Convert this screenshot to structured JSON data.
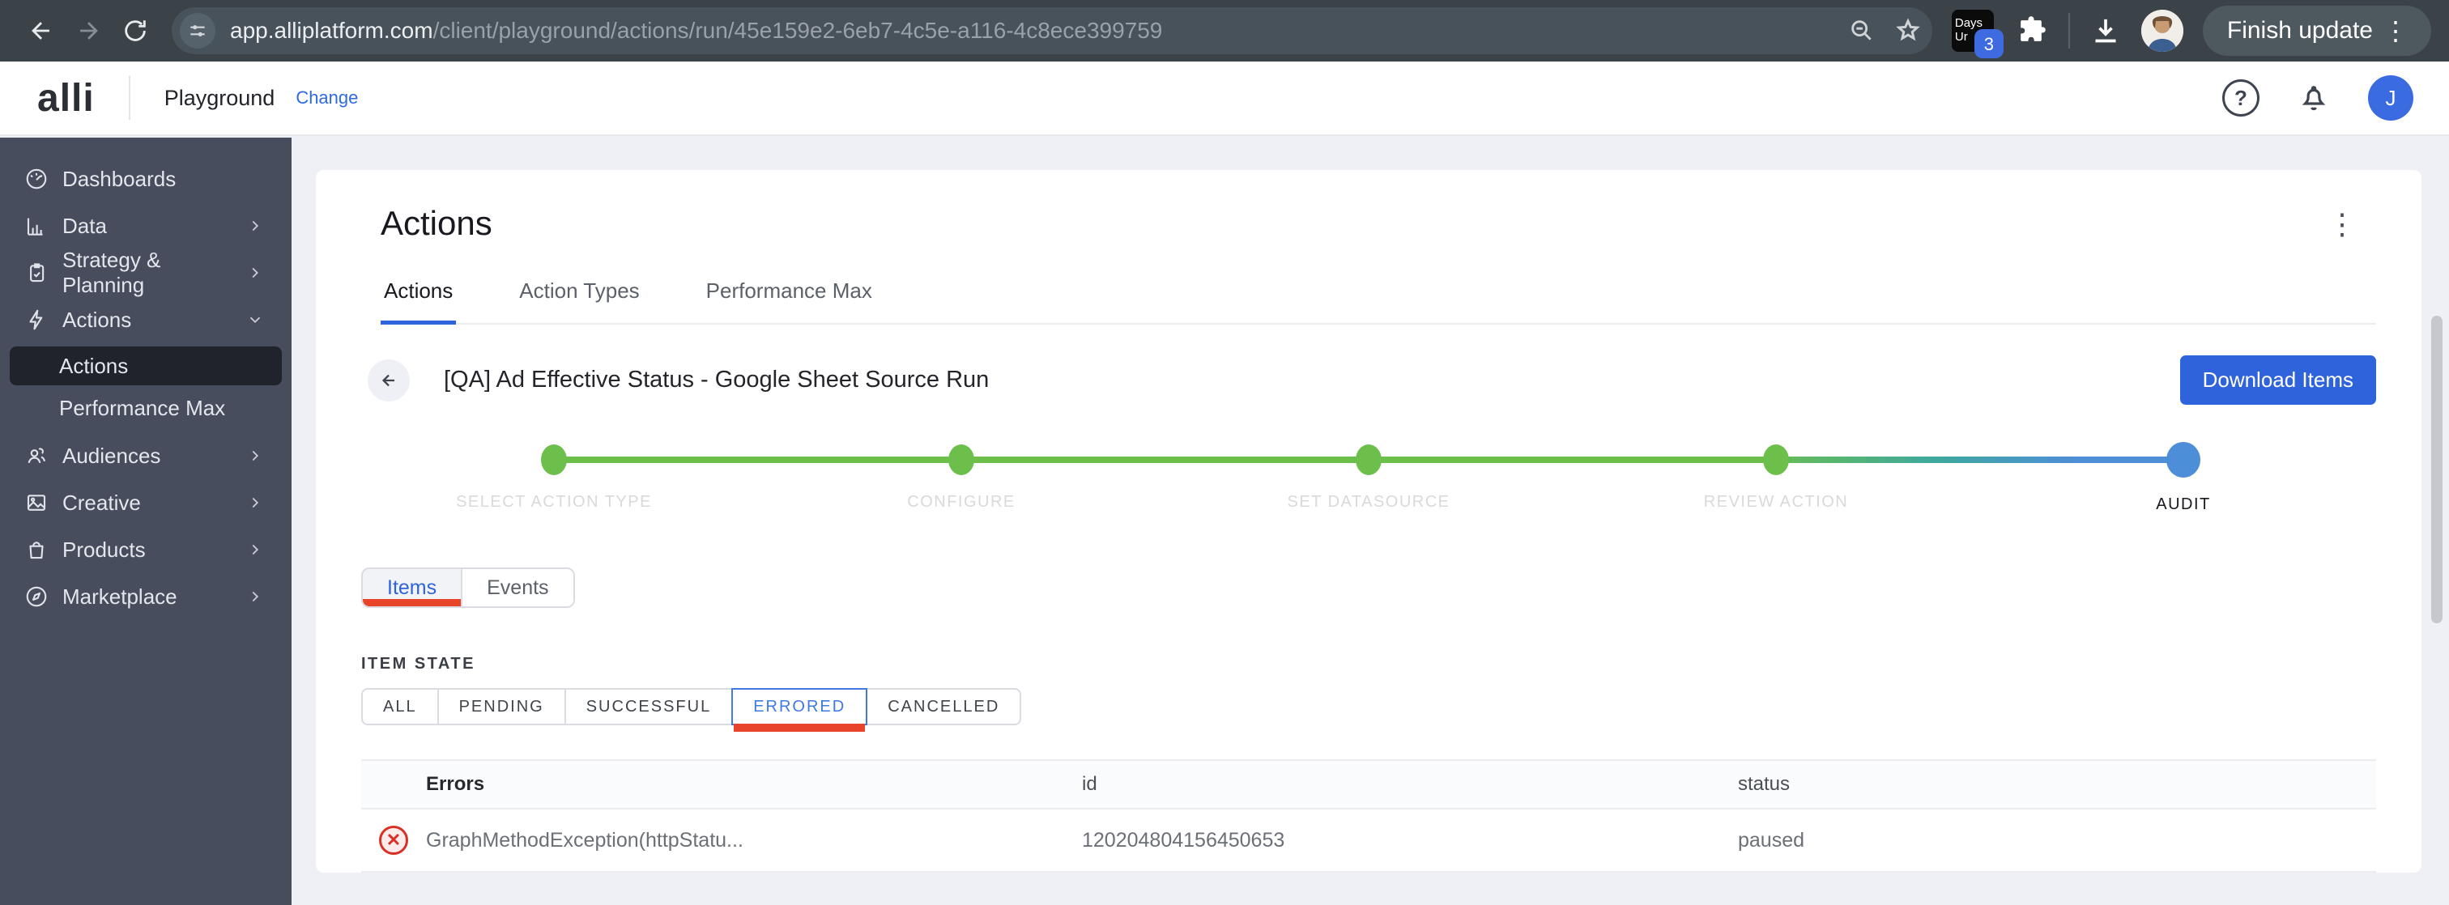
{
  "browser": {
    "url_host": "app.alliplatform.com",
    "url_path": "/client/playground/actions/run/45e159e2-6eb7-4c5e-a116-4c8ece399759",
    "extension_line1": "Days",
    "extension_line2": "Ur",
    "extension_badge": "3",
    "update_button_label": "Finish update",
    "kebab_glyph": "⋮"
  },
  "header": {
    "logo_text": "alli",
    "workspace_name": "Playground",
    "change_link_label": "Change",
    "help_glyph": "?",
    "avatar_initial": "J"
  },
  "sidebar": {
    "items": [
      {
        "label": "Dashboards",
        "icon": "gauge-icon",
        "chevron": "none"
      },
      {
        "label": "Data",
        "icon": "bar-chart-icon",
        "chevron": "right"
      },
      {
        "label": "Strategy & Planning",
        "icon": "clipboard-icon",
        "chevron": "right"
      },
      {
        "label": "Actions",
        "icon": "lightning-icon",
        "chevron": "down"
      },
      {
        "label": "Audiences",
        "icon": "people-icon",
        "chevron": "right"
      },
      {
        "label": "Creative",
        "icon": "image-icon",
        "chevron": "right"
      },
      {
        "label": "Products",
        "icon": "bag-icon",
        "chevron": "right"
      },
      {
        "label": "Marketplace",
        "icon": "compass-icon",
        "chevron": "right"
      }
    ],
    "sub_items": [
      {
        "label": "Actions",
        "selected": true
      },
      {
        "label": "Performance Max",
        "selected": false
      }
    ]
  },
  "main": {
    "page_title": "Actions",
    "kebab_glyph": "⋮",
    "tabs": [
      "Actions",
      "Action Types",
      "Performance Max"
    ],
    "active_tab": "Actions",
    "run_title": "[QA] Ad Effective Status - Google Sheet Source Run",
    "download_button_label": "Download Items",
    "stepper_steps": [
      "SELECT ACTION TYPE",
      "CONFIGURE",
      "SET DATASOURCE",
      "REVIEW ACTION",
      "AUDIT"
    ],
    "stepper_current": "AUDIT",
    "view_tabs": [
      "Items",
      "Events"
    ],
    "active_view_tab": "Items",
    "item_state_label": "ITEM STATE",
    "filters": [
      "ALL",
      "PENDING",
      "SUCCESSFUL",
      "ERRORED",
      "CANCELLED"
    ],
    "active_filter": "ERRORED",
    "table": {
      "columns": [
        "Errors",
        "id",
        "status"
      ],
      "rows": [
        {
          "error": "GraphMethodException(httpStatu...",
          "id": "120204804156450653",
          "status": "paused",
          "error_glyph": "✕"
        }
      ]
    }
  },
  "colors": {
    "accent_blue": "#2f63dc",
    "step_green": "#6cbf4b",
    "step_blue": "#4d8ed8",
    "error_red": "#e8442a",
    "sidebar_bg": "#474d5c"
  }
}
